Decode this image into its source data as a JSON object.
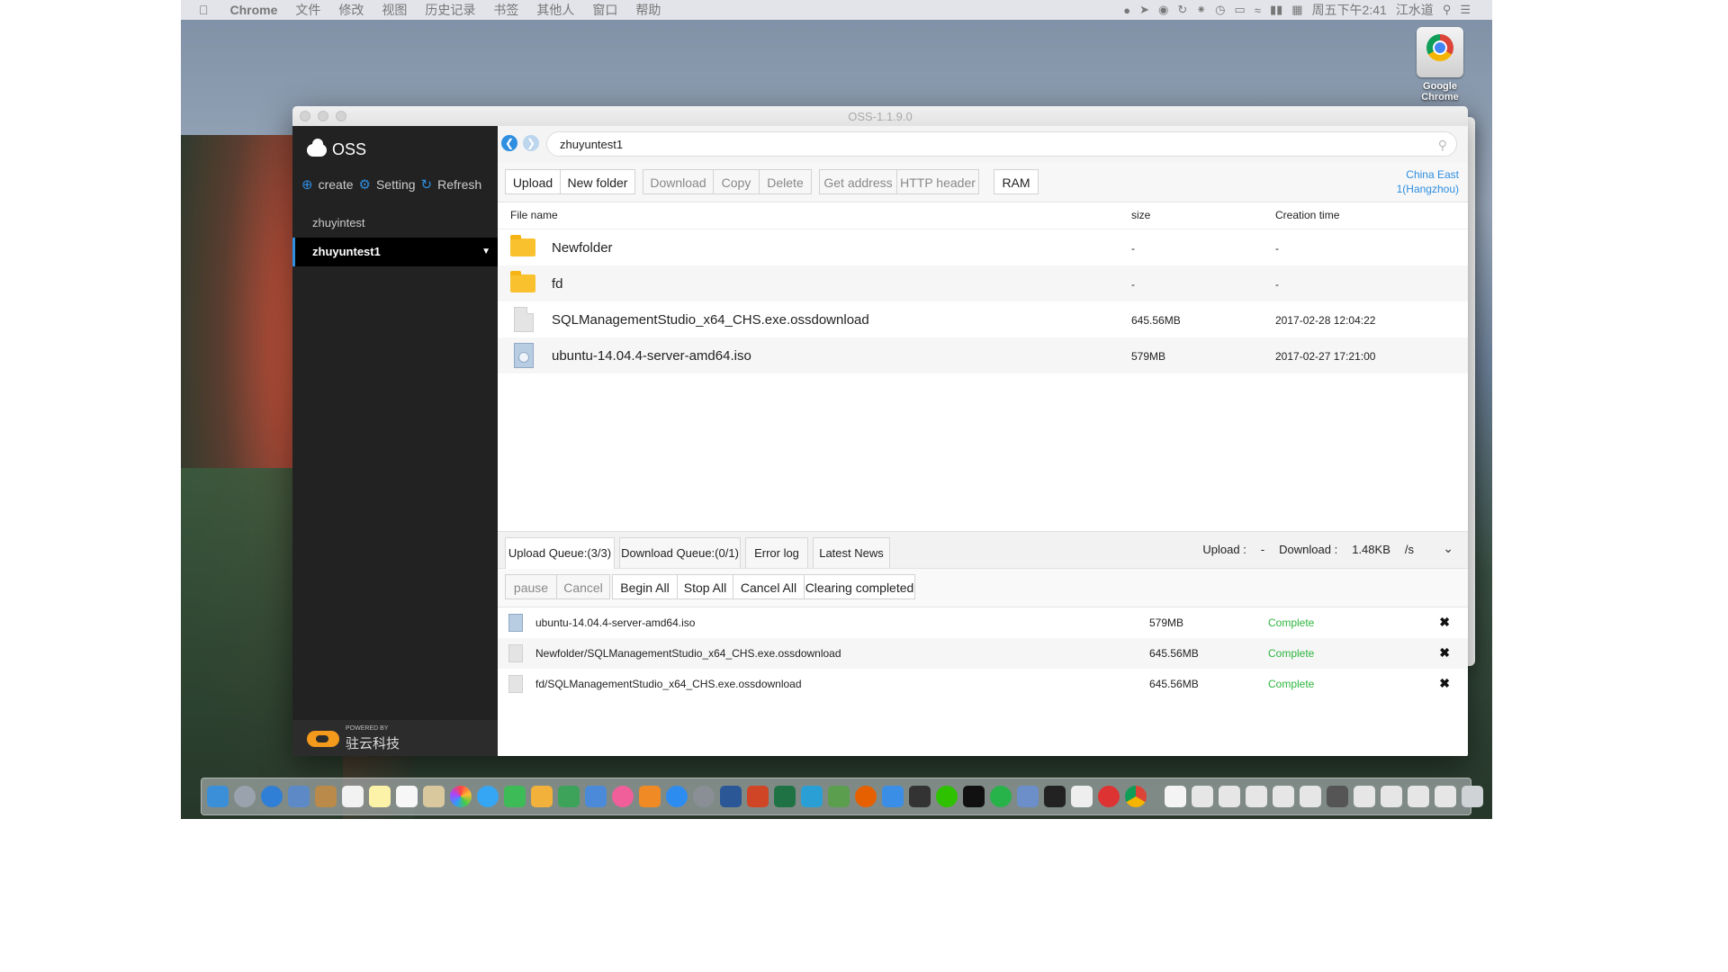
{
  "menubar": {
    "app_name": "Chrome",
    "items": [
      "文件",
      "修改",
      "视图",
      "历史记录",
      "书签",
      "其他人",
      "窗口",
      "帮助"
    ],
    "datetime": "周五下午2:41",
    "user": "江水道"
  },
  "desktop": {
    "chrome_icon_label": "Google Chrome"
  },
  "window": {
    "title": "OSS-1.1.9.0"
  },
  "sidebar": {
    "brand": "OSS",
    "actions": {
      "create": "create",
      "setting": "Setting",
      "refresh": "Refresh"
    },
    "buckets": [
      {
        "name": "zhuyintest"
      },
      {
        "name": "zhuyuntest1"
      }
    ],
    "powered_by": "POWERED BY",
    "company": "驻云科技"
  },
  "addressbar": {
    "path": "zhuyuntest1"
  },
  "toolbar": {
    "upload": "Upload",
    "new_folder": "New folder",
    "download": "Download",
    "copy": "Copy",
    "delete": "Delete",
    "get_address": "Get address",
    "http_header": "HTTP header",
    "ram": "RAM",
    "region_line1": "China East",
    "region_line2": "1(Hangzhou)"
  },
  "files": {
    "headers": {
      "name": "File name",
      "size": "size",
      "time": "Creation time"
    },
    "rows": [
      {
        "name": "Newfolder",
        "size": "-",
        "time": "-",
        "icon": "folder-icon"
      },
      {
        "name": "fd",
        "size": "-",
        "time": "-",
        "icon": "folder-icon"
      },
      {
        "name": "SQLManagementStudio_x64_CHS.exe.ossdownload",
        "size": "645.56MB",
        "time": "2017-02-28 12:04:22",
        "icon": "file-icon"
      },
      {
        "name": "ubuntu-14.04.4-server-amd64.iso",
        "size": "579MB",
        "time": "2017-02-27 17:21:00",
        "icon": "iso-icon"
      }
    ]
  },
  "queue": {
    "tabs": [
      "Upload Queue:(3/3)",
      "Download Queue:(0/1)",
      "Error log",
      "Latest News"
    ],
    "upload_label": "Upload :",
    "upload_value": "-",
    "download_label": "Download :",
    "download_value": "1.48KB",
    "rate_unit": "/s",
    "buttons": {
      "pause": "pause",
      "cancel": "Cancel",
      "begin_all": "Begin All",
      "stop_all": "Stop All",
      "cancel_all": "Cancel All",
      "clearing_completed": "Clearing completed"
    },
    "rows": [
      {
        "name": "ubuntu-14.04.4-server-amd64.iso",
        "size": "579MB",
        "status": "Complete"
      },
      {
        "name": "Newfolder/SQLManagementStudio_x64_CHS.exe.ossdownload",
        "size": "645.56MB",
        "status": "Complete"
      },
      {
        "name": "fd/SQLManagementStudio_x64_CHS.exe.ossdownload",
        "size": "645.56MB",
        "status": "Complete"
      }
    ],
    "status_color": "#2db53e"
  },
  "colors": {
    "accent": "#2e8ee0",
    "sidebar_bg": "#222222"
  }
}
